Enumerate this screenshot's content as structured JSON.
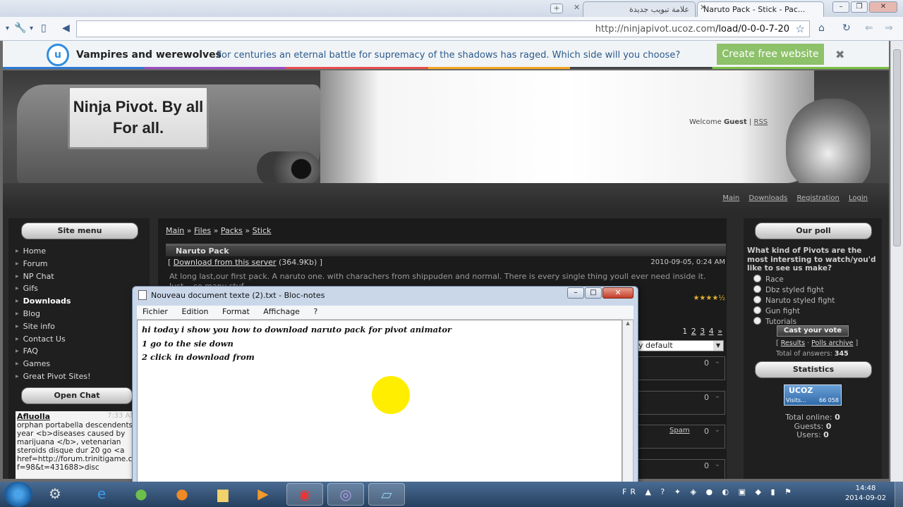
{
  "browser": {
    "tabs": [
      {
        "label": "علامة تبويب جديدة"
      },
      {
        "label": "Naruto Pack - Stick - Pac..."
      }
    ],
    "url_host": "http://ninjapivot.ucoz.com",
    "url_path": "/load/0-0-0-7-20"
  },
  "banner": {
    "logo_letter": "u",
    "heading": "Vampires and werewolves",
    "text": "For centuries an eternal battle for supremacy of the shadows has raged. Which side will you choose?",
    "button": "Create free website",
    "close": "✖"
  },
  "site": {
    "title": "Ninja Pivot. By all For all.",
    "welcome_prefix": "Welcome",
    "welcome_user": "Guest",
    "welcome_sep": "|",
    "rss": "RSS",
    "top_nav": [
      "Main",
      "Downloads",
      "Registration",
      "Login"
    ],
    "site_menu_title": "Site menu",
    "menu": [
      "Home",
      "Forum",
      "NP Chat",
      "Gifs",
      "Downloads",
      "Blog",
      "Site info",
      "Contact Us",
      "FAQ",
      "Games",
      "Great Pivot Sites!"
    ],
    "open_chat_title": "Open Chat",
    "chat": {
      "user": "Afluolla",
      "time": "7:33 AM",
      "text": "orphan portabella descendents year <b>diseases caused by marijuana </b>, vetenarian steroids disque dur 20 go <a href=http://forum.trinitigame.co... f=98&t=431688>disc"
    }
  },
  "main": {
    "breadcrumb": [
      "Main",
      "Files",
      "Packs",
      "Stick"
    ],
    "breadcrumb_sep": "»",
    "file_title": "Naruto Pack",
    "download_link": "Download from this server",
    "download_size": "(364.9Kb)",
    "bracket_open": "[",
    "bracket_close": "]",
    "date": "2010-09-05, 0:24 AM",
    "description": "At long last,our first pack. A naruto one. with charachers from shippuden and normal. There is every single thing youll ever need inside it. Just... so many stuf",
    "stars": "★★★★½",
    "pages": [
      "1",
      "2",
      "3",
      "4",
      "»"
    ],
    "sort_value": "y default",
    "comment_counts": [
      "0",
      "0",
      "0",
      "0"
    ],
    "spam": "Spam"
  },
  "poll": {
    "title": "Our poll",
    "question": "What kind of Pivots are the most intersting to watch/you'd like to see us make?",
    "options": [
      "Race",
      "Dbz styled fight",
      "Naruto styled fight",
      "Gun fight",
      "Tutorials"
    ],
    "vote_button": "Cast your vote",
    "results": "Results",
    "archive": "Polls archive",
    "sep": "·",
    "bracket_open": "[",
    "bracket_close": "]",
    "total_label": "Total of answers:",
    "total_value": "345"
  },
  "statistics": {
    "title": "Statistics",
    "counter_brand": "UCOZ",
    "counter_label": "Visits...",
    "counter_value": "66 058",
    "online_label": "Total online:",
    "online_value": "0",
    "guests_label": "Guests:",
    "guests_value": "0",
    "users_label": "Users:",
    "users_value": "0"
  },
  "notepad": {
    "title": "Nouveau document texte (2).txt - Bloc-notes",
    "menu": [
      "Fichier",
      "Edition",
      "Format",
      "Affichage",
      "?"
    ],
    "lines": [
      "hi today i show you how to download naruto pack for pivot animator",
      "1 go to the sie down",
      "2 click in download from"
    ]
  },
  "taskbar": {
    "lang": "FR",
    "time": "14:48",
    "date": "2014-09-02"
  },
  "colors": {
    "banner_button": "#8dc16a",
    "cursor_highlight": "#ffee00"
  }
}
